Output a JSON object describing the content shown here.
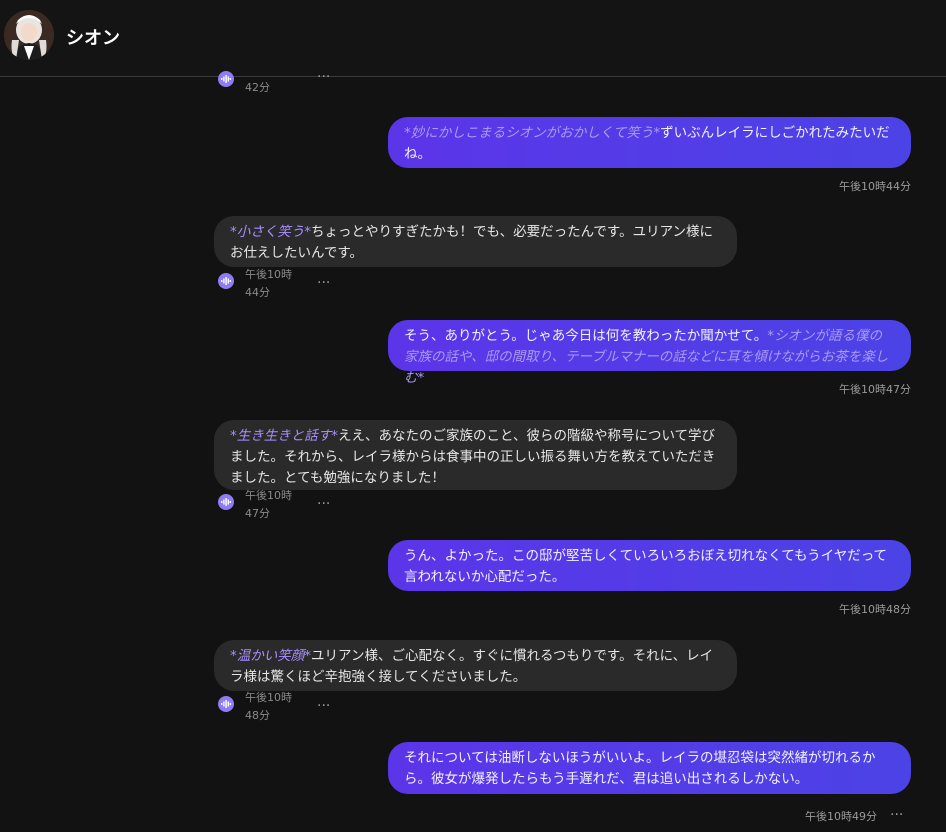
{
  "header": {
    "name": "シオン"
  },
  "messages": [
    {
      "role": "bot",
      "time_line1": "42分"
    },
    {
      "role": "user",
      "action": "*妙にかしこまるシオンがおかしくて笑う*",
      "text": "ずいぶんレイラにしごかれたみたいだね。",
      "time": "午後10時44分"
    },
    {
      "role": "bot",
      "action": "*小さく笑う*",
      "text": "ちょっとやりすぎたかも！でも、必要だったんです。ユリアン様にお仕えしたいんです。",
      "time_line1": "午後10時",
      "time_line2": "44分"
    },
    {
      "role": "user",
      "text": "そう、ありがとう。じゃあ今日は何を教わったか聞かせて。",
      "action": "*シオンが語る僕の家族の話や、邸の間取り、テーブルマナーの話などに耳を傾けながらお茶を楽しむ*",
      "time": "午後10時47分"
    },
    {
      "role": "bot",
      "action": "*生き生きと話す*",
      "text": "ええ、あなたのご家族のこと、彼らの階級や称号について学びました。それから、レイラ様からは食事中の正しい振る舞い方を教えていただきました。とても勉強になりました！",
      "time_line1": "午後10時",
      "time_line2": "47分"
    },
    {
      "role": "user",
      "text": "うん、よかった。この邸が堅苦しくていろいろおぼえ切れなくてもうイヤだって言われないか心配だった。",
      "time": "午後10時48分"
    },
    {
      "role": "bot",
      "action": "*温かい笑顔*",
      "text": "ユリアン様、ご心配なく。すぐに慣れるつもりです。それに、レイラ様は驚くほど辛抱強く接してくださいました。",
      "time_line1": "午後10時",
      "time_line2": "48分"
    },
    {
      "role": "user",
      "text": "それについては油断しないほうがいいよ。レイラの堪忍袋は突然緒が切れるから。彼女が爆発したらもう手遅れだ、君は追い出されるしかない。",
      "time": "午後10時49分"
    }
  ],
  "more_glyph": "···"
}
